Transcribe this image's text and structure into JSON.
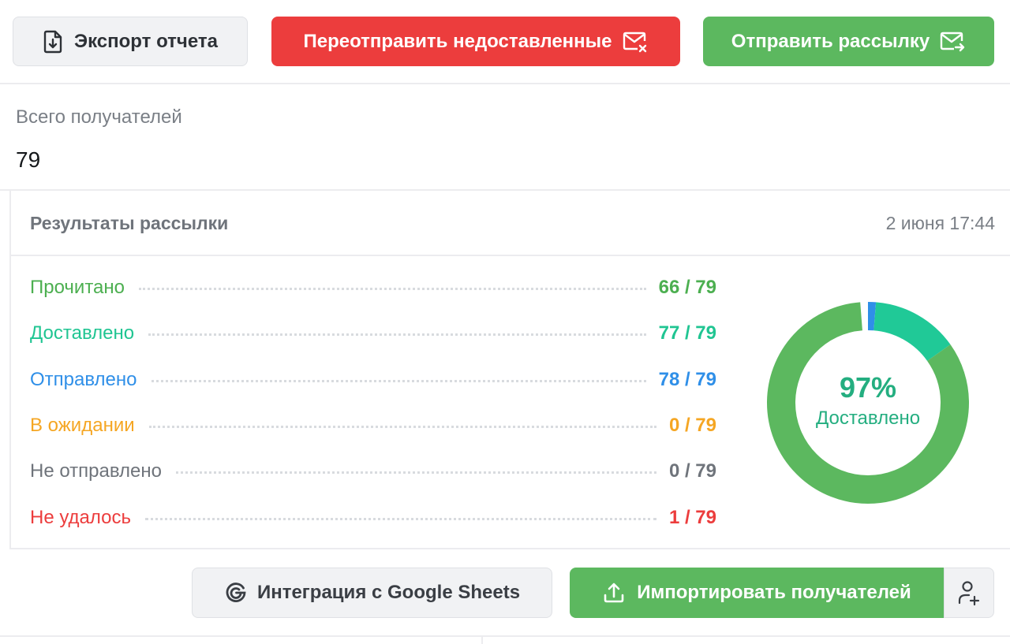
{
  "toolbar": {
    "export_label": "Экспорт отчета",
    "resend_label": "Переотправить недоставленные",
    "send_label": "Отправить рассылку"
  },
  "recipients": {
    "label": "Всего получателей",
    "value": "79"
  },
  "results": {
    "title": "Результаты рассылки",
    "date": "2 июня 17:44",
    "stats": [
      {
        "label": "Прочитано",
        "value": "66 / 79",
        "color": "#4caf50"
      },
      {
        "label": "Доставлено",
        "value": "77 / 79",
        "color": "#20c592"
      },
      {
        "label": "Отправлено",
        "value": "78 / 79",
        "color": "#2f8fe8"
      },
      {
        "label": "В ожидании",
        "value": "0 / 79",
        "color": "#f5a623"
      },
      {
        "label": "Не отправлено",
        "value": "0 / 79",
        "color": "#6f747b"
      },
      {
        "label": "Не удалось",
        "value": "1 / 79",
        "color": "#ec3d3d"
      }
    ],
    "donut": {
      "percent_label": "97%",
      "caption": "Доставлено",
      "total": 79,
      "segments": [
        {
          "name": "read",
          "value": 66,
          "color": "#5cb85f"
        },
        {
          "name": "delivered-unread",
          "value": 11,
          "color": "#20c997"
        },
        {
          "name": "sent-undelivered",
          "value": 1,
          "color": "#2f8fe8"
        },
        {
          "name": "failed",
          "value": 1,
          "color": "#ec3d3d"
        }
      ]
    }
  },
  "bottom": {
    "gsheets_label": "Интеграция с Google Sheets",
    "import_label": "Импортировать получателей"
  }
}
